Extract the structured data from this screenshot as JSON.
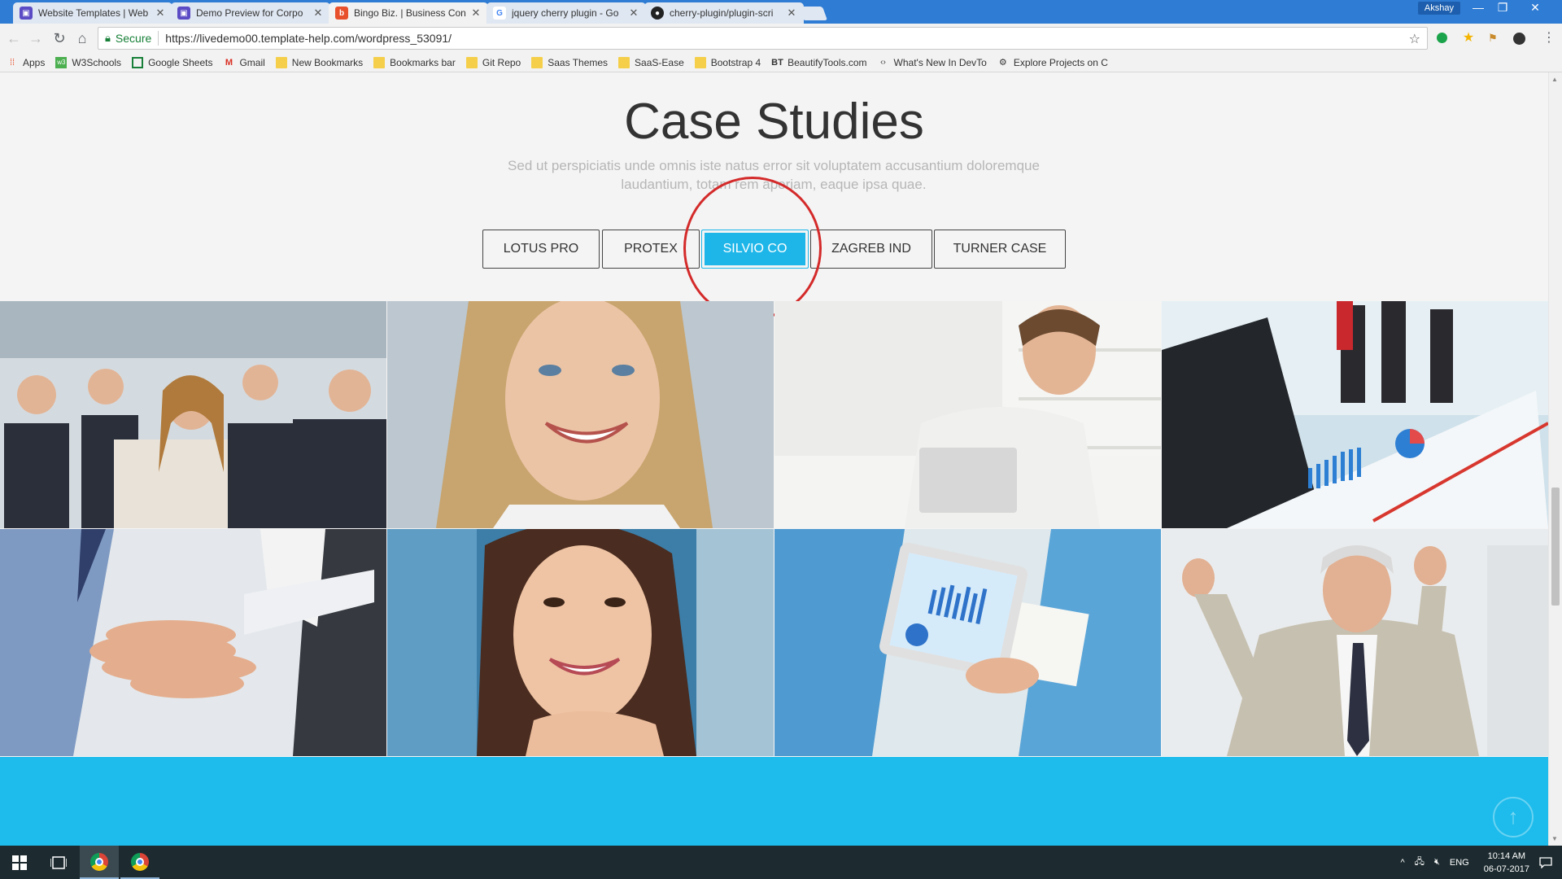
{
  "browser": {
    "tabs": [
      {
        "title": "Website Templates | Web",
        "icon": "template-monster-icon",
        "color": "#5b4bc4",
        "active": false
      },
      {
        "title": "Demo Preview for Corpo",
        "icon": "template-monster-icon",
        "color": "#5b4bc4",
        "active": false
      },
      {
        "title": "Bingo Biz. | Business Con",
        "icon": "site-favicon",
        "color": "#e8502c",
        "active": true
      },
      {
        "title": "jquery cherry plugin - Go",
        "icon": "google-icon",
        "color": "#4285f4",
        "active": false
      },
      {
        "title": "cherry-plugin/plugin-scri",
        "icon": "github-icon",
        "color": "#222222",
        "active": false
      }
    ],
    "profile_name": "Akshay",
    "security_label": "Secure",
    "url": "https://livedemo00.template-help.com/wordpress_53091/"
  },
  "bookmarks": [
    {
      "label": "Apps",
      "icon": "apps-grid-icon"
    },
    {
      "label": "W3Schools",
      "icon": "w3schools-icon"
    },
    {
      "label": "Google Sheets",
      "icon": "sheets-icon"
    },
    {
      "label": "Gmail",
      "icon": "gmail-icon"
    },
    {
      "label": "New Bookmarks",
      "icon": "folder-icon"
    },
    {
      "label": "Bookmarks bar",
      "icon": "folder-icon"
    },
    {
      "label": "Git Repo",
      "icon": "folder-icon"
    },
    {
      "label": "Saas Themes",
      "icon": "folder-icon"
    },
    {
      "label": "SaaS-Ease",
      "icon": "folder-icon"
    },
    {
      "label": "Bootstrap 4",
      "icon": "folder-icon"
    },
    {
      "label": "BeautifyTools.com",
      "icon": "bt-icon"
    },
    {
      "label": "What's New In DevTo",
      "icon": "devtools-icon"
    },
    {
      "label": "Explore Projects on C",
      "icon": "gear-icon"
    }
  ],
  "page": {
    "title": "Case Studies",
    "subtitle": "Sed ut perspiciatis unde omnis iste natus error sit voluptatem accusantium doloremque laudantium, totam rem aperiam, eaque ipsa quae.",
    "filters": [
      {
        "label": "LOTUS PRO",
        "active": false
      },
      {
        "label": "PROTEX",
        "active": false
      },
      {
        "label": "SILVIO CO",
        "active": true
      },
      {
        "label": "ZAGREB IND",
        "active": false
      },
      {
        "label": "TURNER CASE",
        "active": false
      }
    ],
    "accent_color": "#1eb6e9",
    "band_color": "#1dbcec",
    "gallery": [
      {
        "name": "business-team-photo"
      },
      {
        "name": "smiling-blonde-woman-photo"
      },
      {
        "name": "man-with-laptop-photo"
      },
      {
        "name": "office-desk-charts-photo"
      },
      {
        "name": "stacked-hands-photo"
      },
      {
        "name": "smiling-brunette-woman-photo"
      },
      {
        "name": "tablet-chart-photo"
      },
      {
        "name": "celebrating-businessman-photo"
      }
    ]
  },
  "taskbar": {
    "language": "ENG",
    "time": "10:14 AM",
    "date": "06-07-2017"
  }
}
